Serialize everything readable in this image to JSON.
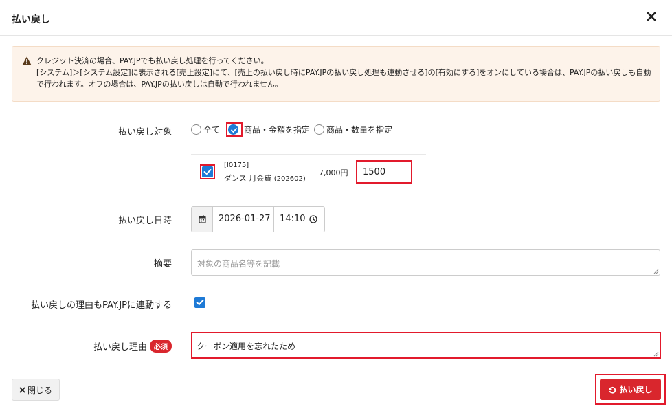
{
  "dialog": {
    "title": "払い戻し"
  },
  "alert": {
    "line1": "クレジット決済の場合、PAY.JPでも払い戻し処理を行ってください。",
    "line2": "[システム]＞[システム設定]に表示される[売上設定]にて、[売上の払い戻し時にPAY.JPの払い戻し処理も連動させる]の[有効にする]をオンにしている場合は、PAY.JPの払い戻しも自動で行われます。オフの場合は、PAY.JPの払い戻しは自動で行われません。"
  },
  "form": {
    "target_label": "払い戻し対象",
    "target_options": [
      "全て",
      "商品・金額を指定",
      "商品・数量を指定"
    ],
    "target_selected": "商品・金額を指定",
    "item": {
      "code": "[I0175]",
      "name": "ダンス 月会費",
      "period": "(202602)",
      "price": "7,000円",
      "amount": "1500",
      "checked": true
    },
    "date_label": "払い戻し日時",
    "date": "2026-01-27",
    "time": "14:10",
    "memo_label": "摘要",
    "memo_placeholder": "対象の商品名等を記載",
    "sync_label": "払い戻しの理由もPAY.JPに連動する",
    "sync_checked": true,
    "reason_label": "払い戻し理由",
    "required_badge": "必須",
    "reason_value": "クーポン適用を忘れたため"
  },
  "footer": {
    "close_label": "閉じる",
    "refund_label": "払い戻し"
  },
  "colors": {
    "accent": "#1e7ad6",
    "danger": "#d9262d",
    "highlight": "#e21a2c",
    "alert_bg": "#fdf3ea"
  }
}
